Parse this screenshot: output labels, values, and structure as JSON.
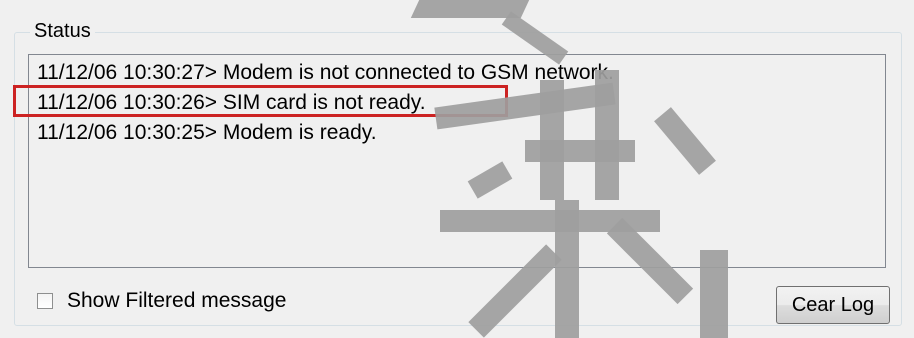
{
  "status_group": {
    "title": "Status",
    "log_lines": [
      "11/12/06 10:30:27> Modem is not connected to GSM network.",
      "11/12/06 10:30:26> SIM card is not ready.",
      "11/12/06 10:30:25> Modem is  ready."
    ],
    "highlight_color": "#cc2222"
  },
  "footer": {
    "show_filtered_label": "Show Filtered message",
    "show_filtered_checked": false,
    "clear_button_label": "Cear Log"
  }
}
